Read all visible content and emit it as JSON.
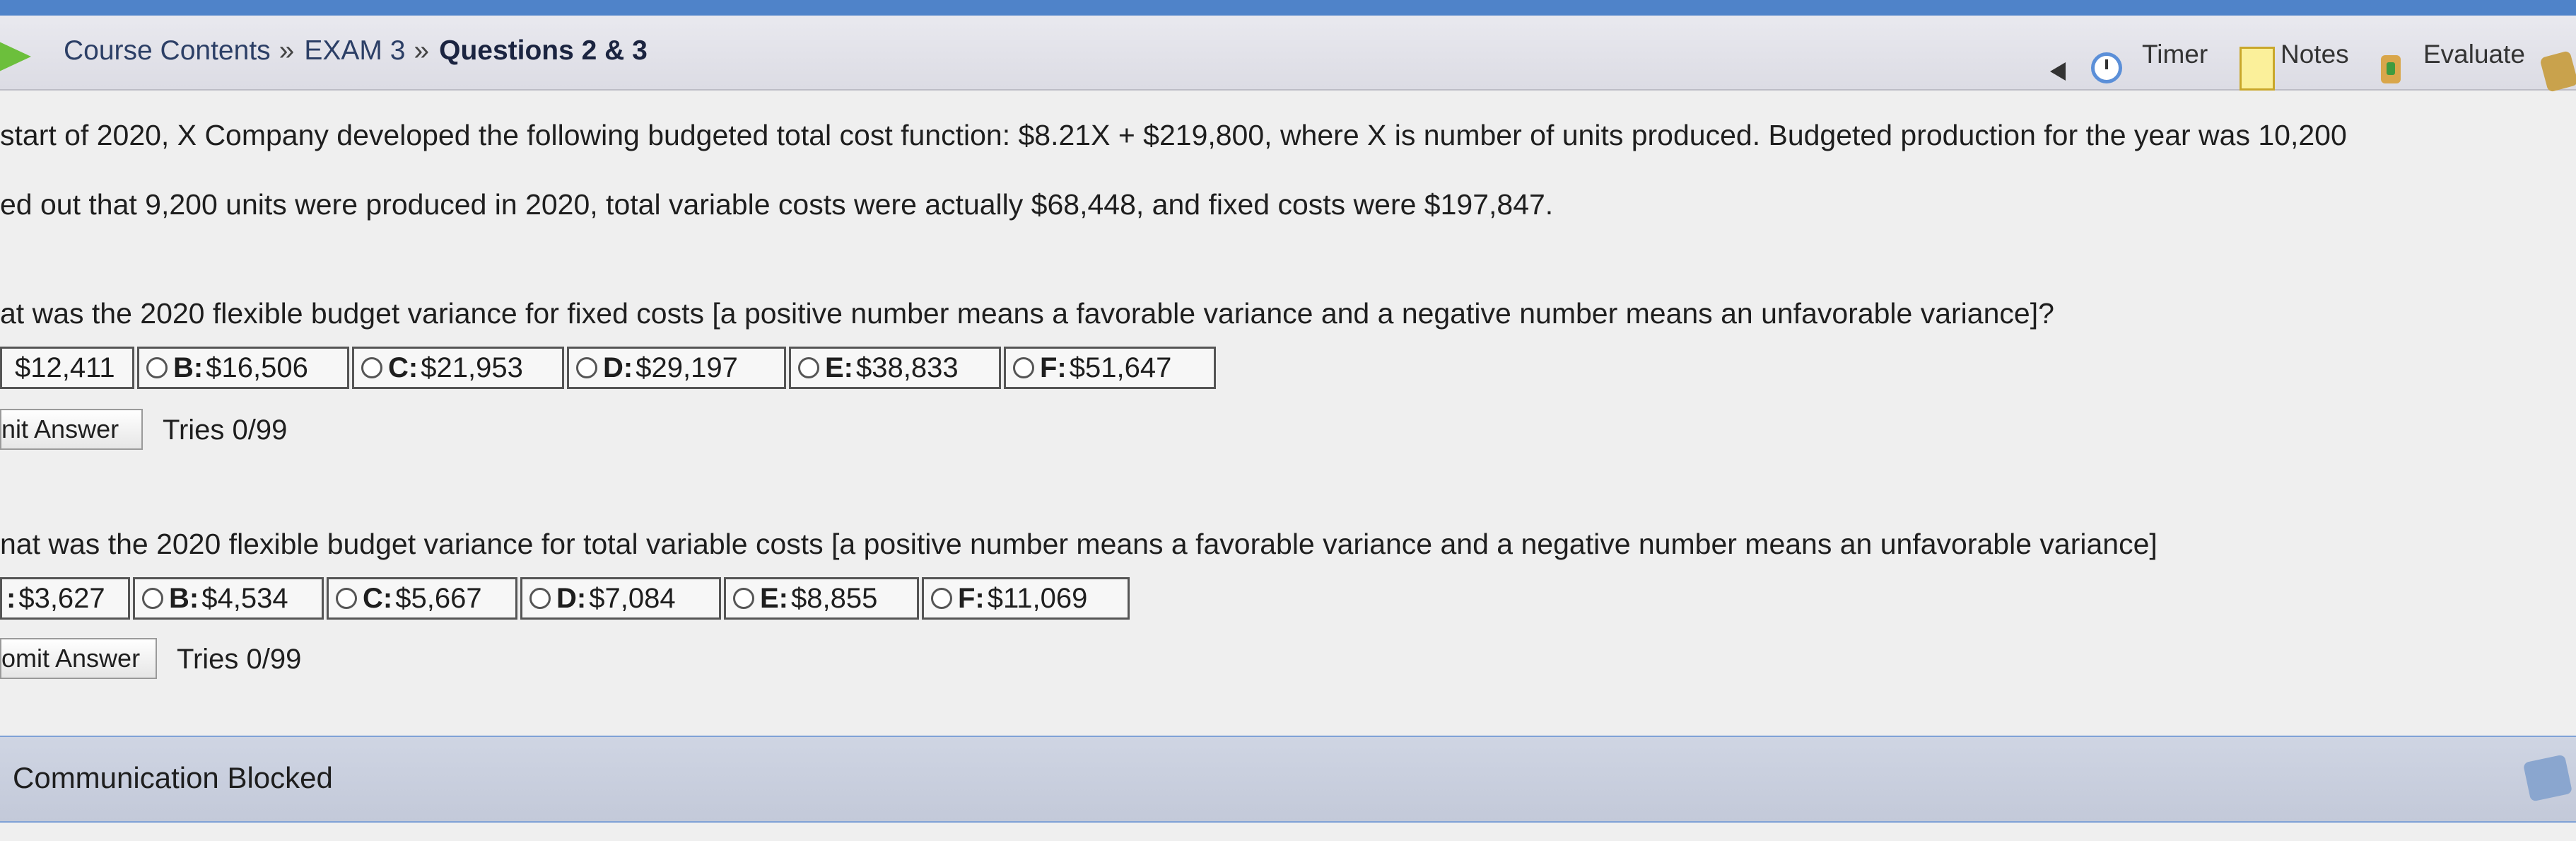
{
  "header": {
    "breadcrumb": [
      "Course Contents",
      "EXAM 3"
    ],
    "separator": "»",
    "current": "Questions 2 & 3",
    "tools": {
      "timer": "Timer",
      "notes": "Notes",
      "evaluate": "Evaluate"
    }
  },
  "problem": {
    "line1": "start of 2020, X Company developed the following budgeted total cost function: $8.21X + $219,800, where X is number of units produced. Budgeted production for the year was 10,200",
    "line2": "ed out that 9,200 units were produced in 2020, total variable costs were actually $68,448, and fixed costs were $197,847."
  },
  "questions": [
    {
      "text": "at was the 2020 flexible budget variance for fixed costs [a positive number means a favorable variance and a negative number means an unfavorable variance]?",
      "options": [
        {
          "letter": "",
          "value": "$12,411"
        },
        {
          "letter": "B:",
          "value": "$16,506"
        },
        {
          "letter": "C:",
          "value": "$21,953"
        },
        {
          "letter": "D:",
          "value": "$29,197"
        },
        {
          "letter": "E:",
          "value": "$38,833"
        },
        {
          "letter": "F:",
          "value": "$51,647"
        }
      ],
      "submit_label": "nit Answer",
      "tries": "Tries 0/99"
    },
    {
      "text": "nat was the 2020 flexible budget variance for total variable costs [a positive number means a favorable variance and a negative number means an unfavorable variance]",
      "options": [
        {
          "letter": ":",
          "value": "$3,627"
        },
        {
          "letter": "B:",
          "value": "$4,534"
        },
        {
          "letter": "C:",
          "value": "$5,667"
        },
        {
          "letter": "D:",
          "value": "$7,084"
        },
        {
          "letter": "E:",
          "value": "$8,855"
        },
        {
          "letter": "F:",
          "value": "$11,069"
        }
      ],
      "submit_label": "omit Answer",
      "tries": "Tries 0/99"
    }
  ],
  "footer": {
    "status": "Communication Blocked"
  },
  "colors": {
    "topbar": "#4f83c9",
    "nav_arrow": "#6cbf3c",
    "footer": "#c9cfdd"
  },
  "icons": [
    "forward-arrow-icon",
    "timer-icon",
    "notes-icon",
    "evaluate-icon",
    "communication-icon"
  ]
}
